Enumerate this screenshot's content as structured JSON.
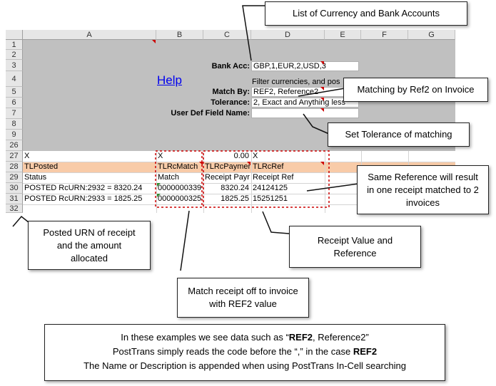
{
  "columns": [
    "A",
    "B",
    "C",
    "D",
    "E",
    "F",
    "G"
  ],
  "rows": [
    "1",
    "2",
    "3",
    "4",
    "5",
    "6",
    "7",
    "8",
    "9",
    "26",
    "27",
    "28",
    "29",
    "30",
    "31",
    "32"
  ],
  "settings": {
    "help_link": "Help",
    "bank_acc_label": "Bank Acc:",
    "bank_acc_value": "GBP,1,EUR,2,USD,3",
    "filter_note": "Filter currencies, and pos",
    "match_by_label": "Match By:",
    "match_by_value": "REF2, Reference2",
    "tolerance_label": "Tolerance:",
    "tolerance_value": "2, Exact and Anything less",
    "user_def_label": "User Def Field Name:",
    "user_def_value": ""
  },
  "table": {
    "row27": {
      "a": "X",
      "b": "X",
      "c": "0.00",
      "d": "X"
    },
    "row28": {
      "a": "TLPosted",
      "b": "TLRcMatch",
      "c": "TLRcPaymer",
      "d": "TLRcRef"
    },
    "row29": {
      "a": "Status",
      "b": "Match",
      "c": "Receipt Payr",
      "d": "Receipt Ref"
    },
    "data": [
      {
        "a": "POSTED RcURN:2932 = 8320.24",
        "b": "0000000339",
        "c": "8320.24",
        "d": "24124125"
      },
      {
        "a": "POSTED RcURN:2933 = 1825.25",
        "b": "0000000325",
        "c": "1825.25",
        "d": "15251251"
      }
    ]
  },
  "callouts": {
    "currency": "List of Currency and Bank Accounts",
    "match_ref2": "Matching by Ref2 on Invoice",
    "tolerance": "Set Tolerance of matching",
    "same_ref": "Same Reference will result in one receipt matched to 2 invoices",
    "posted_urn": "Posted URN of receipt and the amount allocated",
    "receipt_value": "Receipt Value and Reference",
    "match_receipt": "Match receipt off to invoice with REF2 value"
  },
  "note": {
    "line1_pre": "In these examples we see data such as “",
    "line1_bold": "REF2",
    "line1_post": ", Reference2”",
    "line2_pre": "PostTrans simply reads the code before the “,” in the case ",
    "line2_bold": "REF2",
    "line3": "The Name or Description is appended when using PostTrans In-Cell searching"
  },
  "colors": {
    "settings_bg": "#c0c0c0",
    "header_row_bg": "#f8cba8",
    "accent_red": "#cc0000",
    "link_blue": "#0000ee"
  }
}
